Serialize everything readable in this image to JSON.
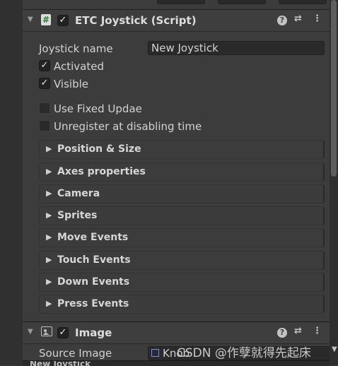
{
  "etc_component": {
    "title": "ETC Joystick (Script)",
    "enabled": true,
    "header_icons": [
      "help-icon",
      "preset-icon",
      "kebab-menu-icon"
    ],
    "joystick_name_label": "Joystick name",
    "joystick_name_value": "New Joystick",
    "activated": {
      "label": "Activated",
      "checked": true
    },
    "visible": {
      "label": "Visible",
      "checked": true
    },
    "use_fixed_update": {
      "label": "Use Fixed Updae",
      "checked": false
    },
    "unregister": {
      "label": "Unregister at disabling time",
      "checked": false
    },
    "sections": [
      "Position & Size",
      "Axes properties",
      "Camera",
      "Sprites",
      "Move Events",
      "Touch Events",
      "Down Events",
      "Press Events"
    ]
  },
  "image_component": {
    "title": "Image",
    "enabled": true,
    "source_image_label": "Source Image",
    "source_image_value": "Knob"
  },
  "watermark": "CSDN @作孽就得先起床",
  "bottom_row_partial": "New Joystick",
  "colors": {
    "panel_bg": "#3c3c3c",
    "field_bg": "#2a2a2a",
    "script_icon_green": "#2e7d32"
  }
}
